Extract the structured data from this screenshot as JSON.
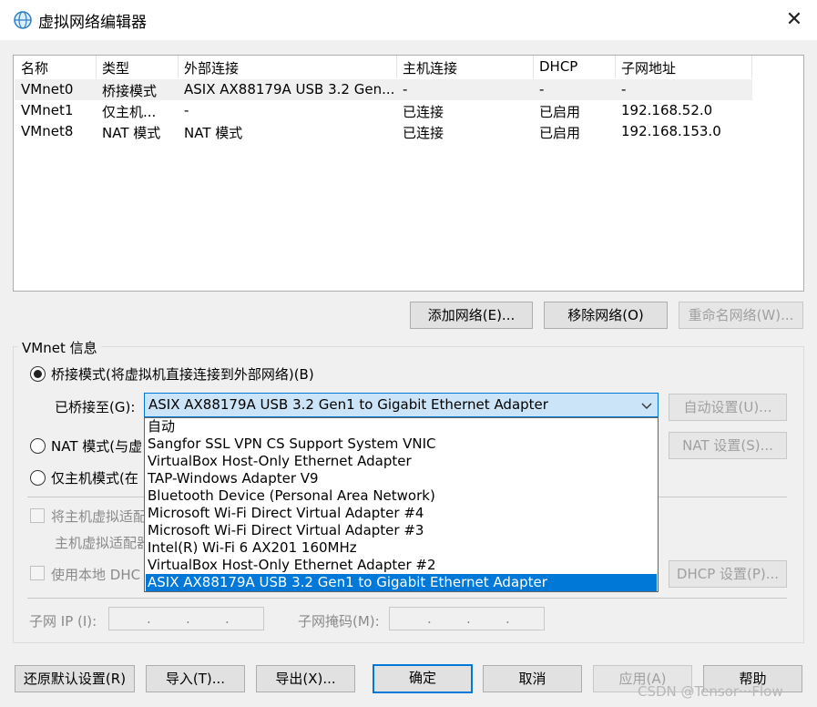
{
  "window": {
    "title": "虚拟网络编辑器",
    "close_glyph": "✕"
  },
  "list": {
    "columns": [
      "名称",
      "类型",
      "外部连接",
      "主机连接",
      "DHCP",
      "子网地址"
    ],
    "rows": [
      [
        "VMnet0",
        "桥接模式",
        "ASIX AX88179A USB 3.2 Gen...",
        "-",
        "-",
        "-"
      ],
      [
        "VMnet1",
        "仅主机...",
        "-",
        "已连接",
        "已启用",
        "192.168.52.0"
      ],
      [
        "VMnet8",
        "NAT 模式",
        "NAT 模式",
        "已连接",
        "已启用",
        "192.168.153.0"
      ]
    ]
  },
  "buttons": {
    "add_network": "添加网络(E)...",
    "remove_network": "移除网络(O)",
    "rename_network": "重命名网络(W)...",
    "auto_settings": "自动设置(U)...",
    "nat_settings": "NAT 设置(S)...",
    "dhcp_settings": "DHCP 设置(P)...",
    "restore_defaults": "还原默认设置(R)",
    "import": "导入(T)...",
    "export": "导出(X)...",
    "ok": "确定",
    "cancel": "取消",
    "apply": "应用(A)",
    "help": "帮助"
  },
  "vmnet_info": {
    "group_label": "VMnet 信息",
    "bridged_label": "桥接模式(将虚拟机直接连接到外部网络)(B)",
    "bridged_to_label": "已桥接至(G):",
    "bridged_selected": "ASIX AX88179A USB 3.2 Gen1 to Gigabit Ethernet Adapter",
    "nat_label": "NAT 模式(与虚",
    "host_only_label": "仅主机模式(在",
    "connect_adapter_label": "将主机虚拟适配",
    "adapter_name_label": "主机虚拟适配器",
    "use_dhcp_label": "使用本地 DHC",
    "subnet_ip_label": "子网 IP (I):",
    "subnet_mask_label": "子网掩码(M):"
  },
  "adapter_options": [
    "自动",
    "Sangfor SSL VPN CS Support System VNIC",
    "VirtualBox Host-Only Ethernet Adapter",
    "TAP-Windows Adapter V9",
    "Bluetooth Device (Personal Area Network)",
    "Microsoft Wi-Fi Direct Virtual Adapter #4",
    "Microsoft Wi-Fi Direct Virtual Adapter #3",
    "Intel(R) Wi-Fi 6 AX201 160MHz",
    "VirtualBox Host-Only Ethernet Adapter #2",
    "ASIX AX88179A USB 3.2 Gen1 to Gigabit Ethernet Adapter"
  ],
  "watermark": "CSDN @Tensor···Flow",
  "icons": {
    "app": "network-globe-icon",
    "dropdown": "chevron-down-icon"
  },
  "colors": {
    "accent": "#0078d7",
    "selection_bg": "#cce4f7"
  }
}
